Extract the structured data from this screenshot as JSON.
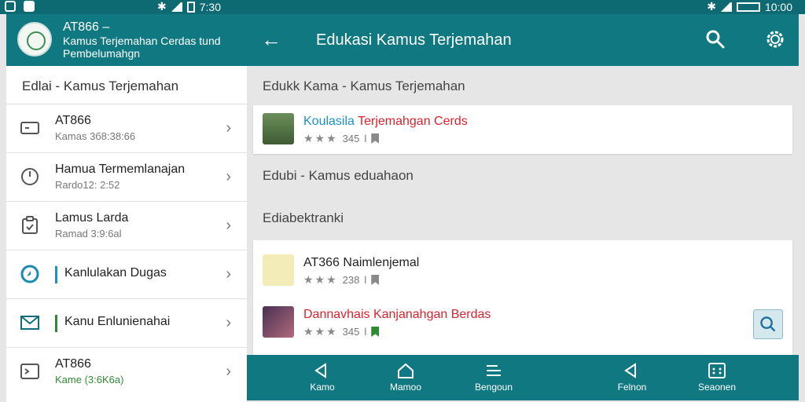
{
  "status": {
    "left_time": "7:30",
    "right_time": "10:00"
  },
  "app": {
    "name": "AT866 –",
    "subtitle": "Kamus Terjemahan Cerdas tund Pembelumahgn"
  },
  "topbar": {
    "title": "Edukasi Kamus Terjemahan"
  },
  "left": {
    "header": "Edlai - Kamus Terjemahan",
    "items": [
      {
        "title": "AT866",
        "sub": "Kamas 3б8:38:66",
        "icon": "keyboard-icon"
      },
      {
        "title": "Hamua Termemlanajan",
        "sub": "Rardo12: 2:52",
        "icon": "clock-icon"
      },
      {
        "title": "Lamus Larda",
        "sub": "Ramad 3:9:6al",
        "icon": "clipboard-icon"
      },
      {
        "title": "Kanlulakan Dugas",
        "sub": "",
        "icon": "refresh-icon",
        "bar": "#1e90c8"
      },
      {
        "title": "Kanu Enlunienahai",
        "sub": "",
        "icon": "mail-icon",
        "bar": "#2e8b34"
      },
      {
        "title": "AT866",
        "sub": "Kame (3:6K6a)",
        "icon": "terminal-icon",
        "sub_green": true
      }
    ]
  },
  "right": {
    "section1": "Edukk Kama - Kamus Terjemahan",
    "card1": {
      "name": "Koulasila Terjemahgan Cerds",
      "rating": "345",
      "sep": "l"
    },
    "section2": "Edubi - Kamus eduahaon",
    "section3": "Ediabektranki",
    "card2": [
      {
        "name": "AT366 Naimlenjemal",
        "rating": "238",
        "sep": "l"
      },
      {
        "name": "Dannavhais Kanjanahgan Berdas",
        "rating": "345",
        "sep": "l"
      }
    ]
  },
  "bottomnav": [
    {
      "label": "Kamo",
      "icon": "navigate-icon"
    },
    {
      "label": "Mamoo",
      "icon": "home-icon"
    },
    {
      "label": "Bengoun",
      "icon": "edit-list-icon"
    },
    {
      "label": "Felnon",
      "icon": "navigate-icon"
    },
    {
      "label": "Seaonen",
      "icon": "grid-icon"
    }
  ],
  "colors": {
    "teal": "#0f7880",
    "blue_link": "#1e90c8",
    "red_link": "#d9232e",
    "green": "#2e8b34"
  }
}
